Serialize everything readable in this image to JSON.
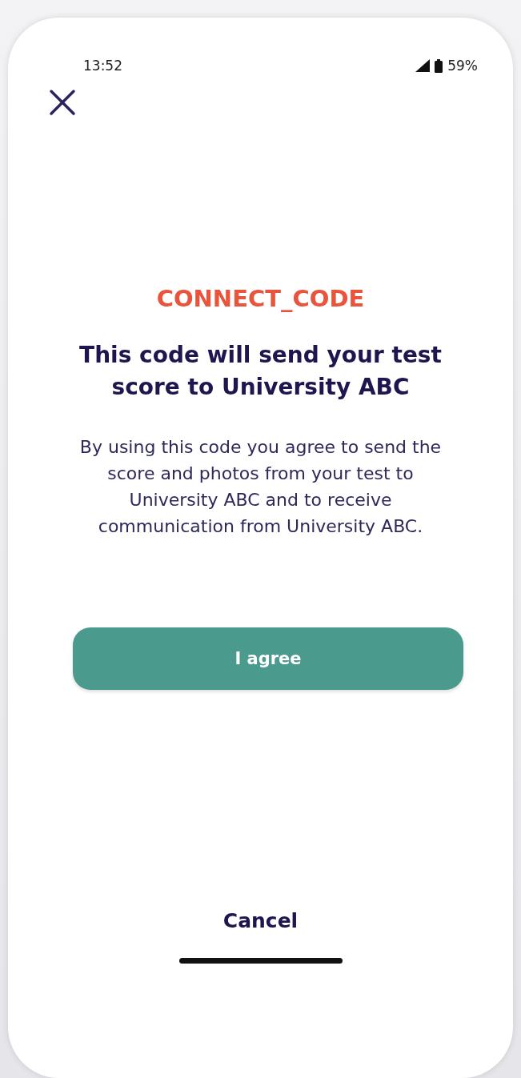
{
  "status_bar": {
    "time": "13:52",
    "battery": "59%"
  },
  "code": "CONNECT_CODE",
  "heading": "This code will send your test score to University ABC",
  "body": "By using this code you agree to send the score and photos from your test to University ABC and to receive communication from University ABC.",
  "buttons": [
    {
      "label": "I agree",
      "kind": "primary"
    },
    {
      "label": "Cancel",
      "kind": "text"
    }
  ]
}
